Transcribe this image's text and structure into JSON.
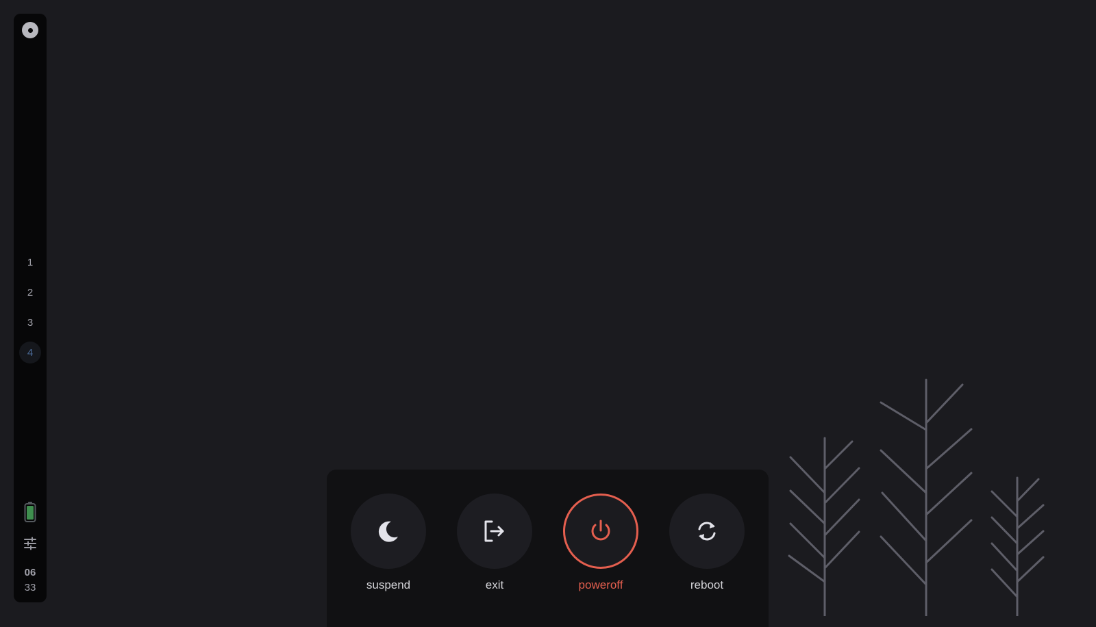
{
  "sidebar": {
    "workspaces": [
      {
        "label": "1",
        "active": false
      },
      {
        "label": "2",
        "active": false
      },
      {
        "label": "3",
        "active": false
      },
      {
        "label": "4",
        "active": true
      }
    ],
    "battery_level": 1.0,
    "battery_color": "#3f8f4f",
    "clock": {
      "hours": "06",
      "minutes": "33"
    },
    "icons": [
      "os-logo-icon",
      "battery-icon",
      "sliders-icon"
    ]
  },
  "power_menu": {
    "buttons": [
      {
        "id": "suspend",
        "label": "suspend",
        "icon": "moon-icon",
        "selected": false
      },
      {
        "id": "exit",
        "label": "exit",
        "icon": "logout-icon",
        "selected": false
      },
      {
        "id": "poweroff",
        "label": "poweroff",
        "icon": "power-icon",
        "selected": true
      },
      {
        "id": "reboot",
        "label": "reboot",
        "icon": "refresh-icon",
        "selected": false
      }
    ],
    "accent_color": "#e55f4f"
  },
  "background": {
    "decoration": "tree-outlines",
    "color": "#5e5e68"
  }
}
